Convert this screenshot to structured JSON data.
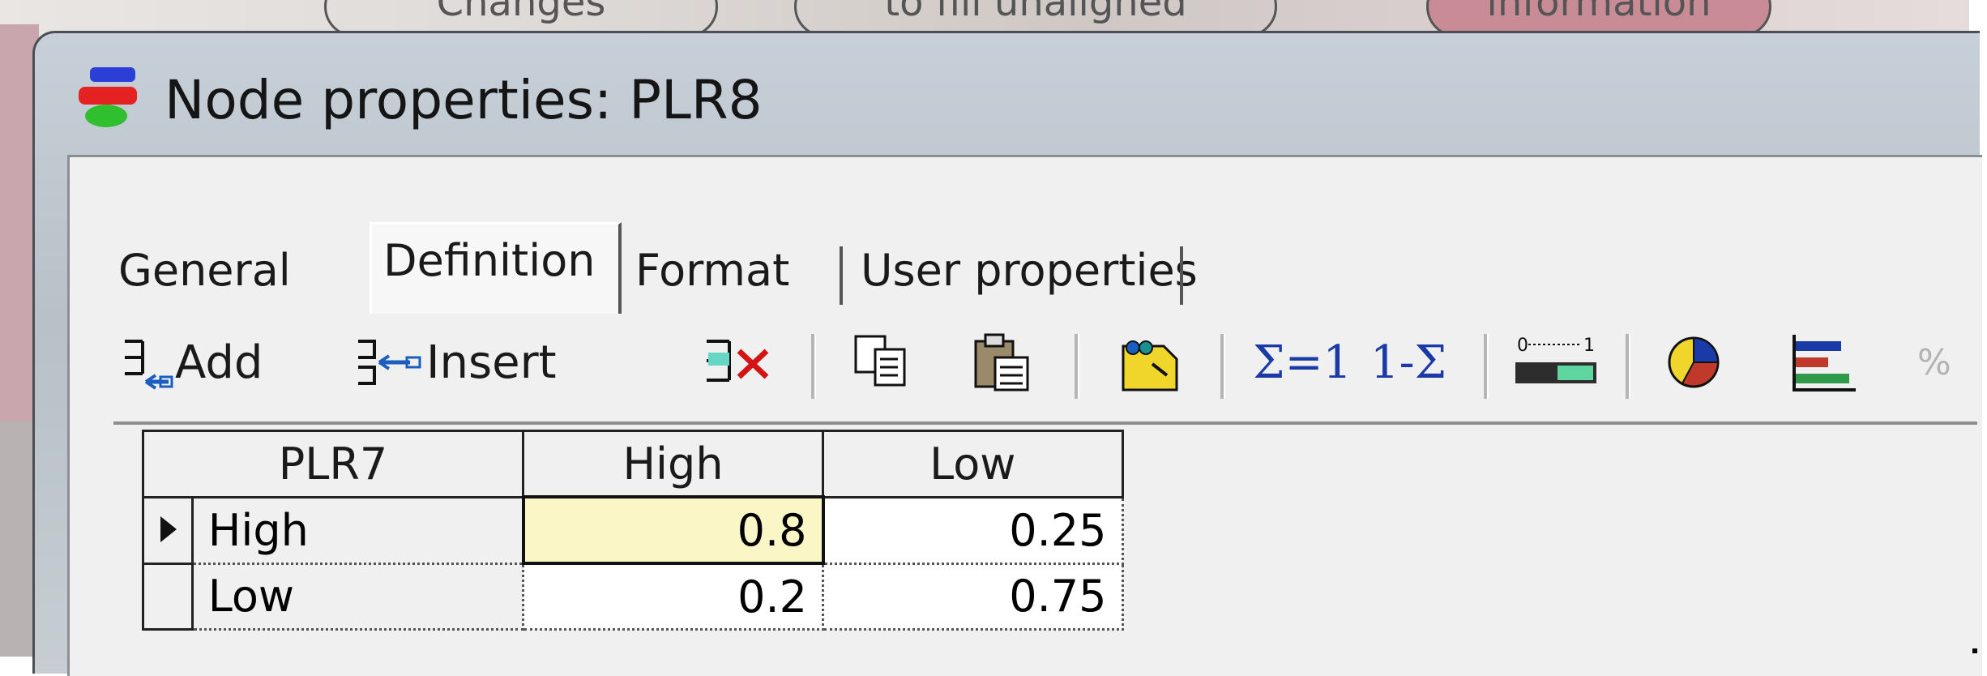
{
  "background": {
    "pills": [
      "Changes",
      "to fill unaligned",
      "information"
    ]
  },
  "window": {
    "title": "Node properties: PLR8"
  },
  "tabs": [
    {
      "label": "General"
    },
    {
      "label": "Definition",
      "active": true
    },
    {
      "label": "Format"
    },
    {
      "label": "User properties"
    }
  ],
  "toolbar": {
    "add_label": "Add",
    "insert_label": "Insert",
    "sum1_label": "Σ=1",
    "one_minus_sum_label": "1-Σ",
    "range_label_low": "0",
    "range_label_high": "1",
    "percent_label": "%"
  },
  "table": {
    "parent_header": "PLR7",
    "columns": [
      "High",
      "Low"
    ],
    "rows": [
      {
        "label": "High",
        "values": [
          "0.8",
          "0.25"
        ]
      },
      {
        "label": "Low",
        "values": [
          "0.2",
          "0.75"
        ]
      }
    ]
  }
}
